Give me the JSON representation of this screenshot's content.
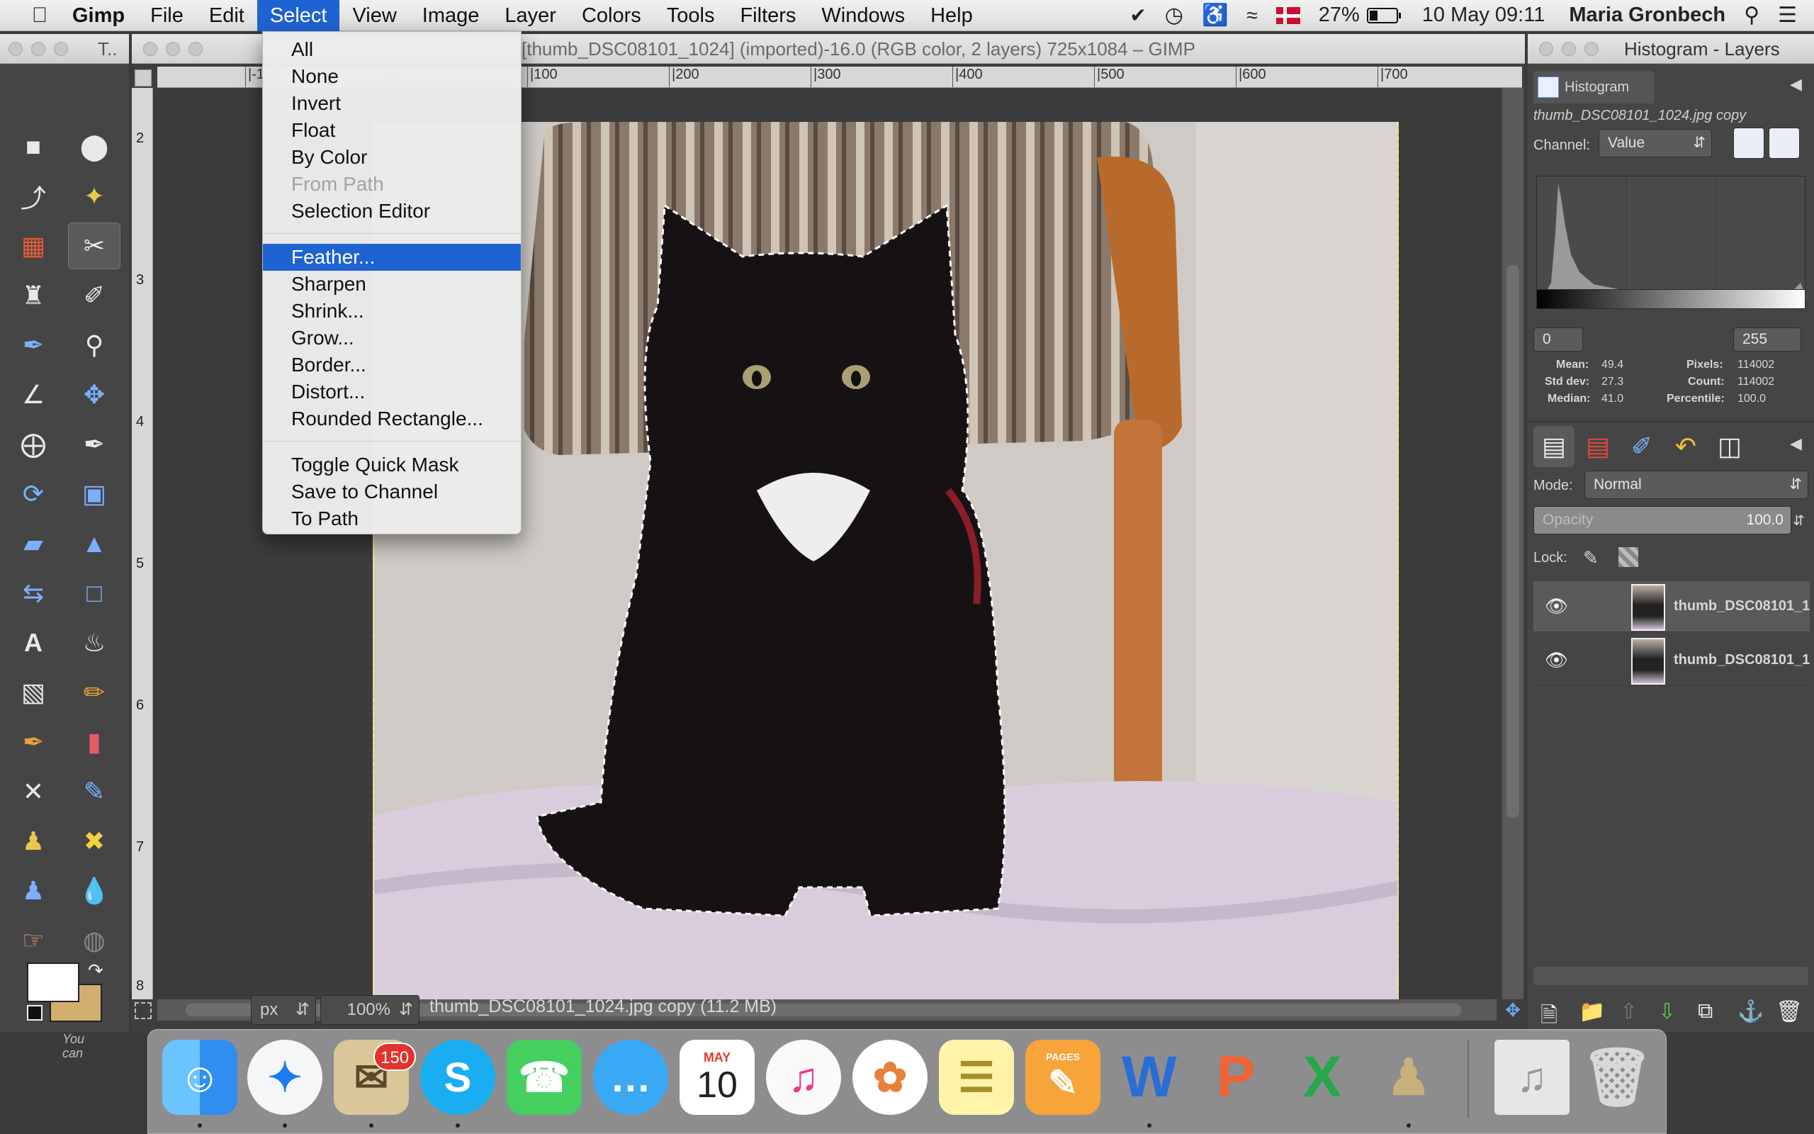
{
  "menubar": {
    "app_name": "Gimp",
    "items": [
      "File",
      "Edit",
      "Select",
      "View",
      "Image",
      "Layer",
      "Colors",
      "Tools",
      "Filters",
      "Windows",
      "Help"
    ],
    "battery": "27%",
    "date_time": "10 May  09:11",
    "user": "Maria Gronbech"
  },
  "toolbox": {
    "title": "T..",
    "hint": "You can"
  },
  "image_window": {
    "title": "[thumb_DSC08101_1024] (imported)-16.0 (RGB color, 2 layers) 725x1084 – GIMP",
    "ruler_top": [
      "|-100",
      "|0",
      "|100",
      "|200",
      "|300",
      "|400",
      "|500",
      "|600",
      "|700"
    ],
    "ruler_left": [
      "2",
      "3",
      "4",
      "5",
      "6",
      "7",
      "8"
    ],
    "unit": "px",
    "zoom": "100%",
    "status": "thumb_DSC08101_1024.jpg copy (11.2 MB)"
  },
  "select_menu": {
    "groups": [
      [
        {
          "label": "All",
          "enabled": true
        },
        {
          "label": "None",
          "enabled": true
        },
        {
          "label": "Invert",
          "enabled": true
        },
        {
          "label": "Float",
          "enabled": true
        },
        {
          "label": "By Color",
          "enabled": true
        },
        {
          "label": "From Path",
          "enabled": false
        },
        {
          "label": "Selection Editor",
          "enabled": true
        }
      ],
      [
        {
          "label": "Feather...",
          "enabled": true,
          "highlighted": true
        },
        {
          "label": "Sharpen",
          "enabled": true
        },
        {
          "label": "Shrink...",
          "enabled": true
        },
        {
          "label": "Grow...",
          "enabled": true
        },
        {
          "label": "Border...",
          "enabled": true
        },
        {
          "label": "Distort...",
          "enabled": true
        },
        {
          "label": "Rounded Rectangle...",
          "enabled": true
        }
      ],
      [
        {
          "label": "Toggle Quick Mask",
          "enabled": true
        },
        {
          "label": "Save to Channel",
          "enabled": true
        },
        {
          "label": "To Path",
          "enabled": true
        }
      ]
    ]
  },
  "histogram_dock": {
    "title": "Histogram - Layers",
    "tab": "Histogram",
    "layer_name": "thumb_DSC08101_1024.jpg copy",
    "channel_label": "Channel:",
    "channel_value": "Value",
    "range_min": "0",
    "range_max": "255",
    "stats": {
      "mean_label": "Mean:",
      "mean": "49.4",
      "std_label": "Std dev:",
      "std": "27.3",
      "median_label": "Median:",
      "median": "41.0",
      "pixels_label": "Pixels:",
      "pixels": "114002",
      "count_label": "Count:",
      "count": "114002",
      "percentile_label": "Percentile:",
      "percentile": "100.0"
    }
  },
  "layers_dock": {
    "mode_label": "Mode:",
    "mode_value": "Normal",
    "opacity_label": "Opacity",
    "opacity_value": "100.0",
    "lock_label": "Lock:",
    "layers": [
      {
        "name": "thumb_DSC08101_1",
        "selected": true
      },
      {
        "name": "thumb_DSC08101_1",
        "selected": false
      }
    ]
  },
  "dock": {
    "mail_badge": "150",
    "calendar_month": "MAY",
    "calendar_day": "10",
    "pages_label": "PAGES",
    "apps": [
      "Finder",
      "Safari",
      "Mail",
      "Skype",
      "FaceTime",
      "Messages",
      "Calendar",
      "iTunes",
      "Photos",
      "Notes",
      "Pages",
      "Word",
      "PowerPoint",
      "Excel",
      "GIMP",
      "Music Folder",
      "Trash"
    ]
  },
  "colors": {
    "accent": "#1f63d3",
    "foreground_color": "#ffffff",
    "background_color": "#d2ae6f",
    "selection_marching_ants": "#ffe66d"
  }
}
